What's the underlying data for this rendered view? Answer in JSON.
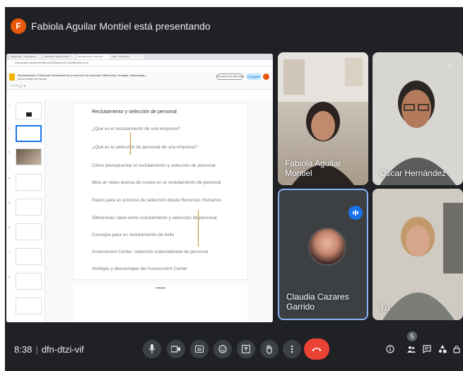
{
  "header": {
    "avatar_letter": "F",
    "title": "Fabiola Aguilar Montiel está presentando"
  },
  "presentation": {
    "browser_tabs": [
      "Instituto IEU - Licenciatura...",
      "Actividad 2 Selección Rec...",
      "Reclutamiento y selección ...",
      "Meet - dfn-dtzi-vif"
    ],
    "url": "docs.google.com/presentation/d/1Ml0aMaVsAC1Q/edit#slide=id.p2",
    "doc_title": "Reclutamiento 2 Selección Reclutamiento y selección de personal, Diferencias, ventajas, desventajas ...",
    "doc_menu": "Archivo  Editar  Ver  Insertar",
    "presenter_button": "Presentación de diapositivas",
    "share_button": "Compartir",
    "slide": {
      "title": "Reclutamiento y selección de personal",
      "items": [
        "¿Qué es el reclutamiento de una empresa?",
        "¿Qué es la selección de personal de una empresa?",
        "Cómo presupuestar el reclutamiento y selección de personal",
        "Mira un video acerca de costes en el reclutamiento de personal",
        "Pasos para un proceso de selección desde Recursos Humanos",
        "Diferencias clave entre reclutamiento y selección de personal",
        "Consejos para un reclutamiento de éxito",
        "Assessment Center, selección especializada de personal",
        "Ventajas y desventajas del Assessment Center"
      ]
    }
  },
  "participants": [
    {
      "name": "Fabiola Aguilar Montiel"
    },
    {
      "name": "Oscar Hernández"
    },
    {
      "name": "Claudia Cazares Garrido"
    },
    {
      "name": "Tú"
    }
  ],
  "footer": {
    "time": "8:38",
    "meeting_code": "dfn-dtzi-vif",
    "participant_count": "5"
  },
  "colors": {
    "background": "#202124",
    "hangup": "#ea4335",
    "speaking": "#1a73e8"
  }
}
